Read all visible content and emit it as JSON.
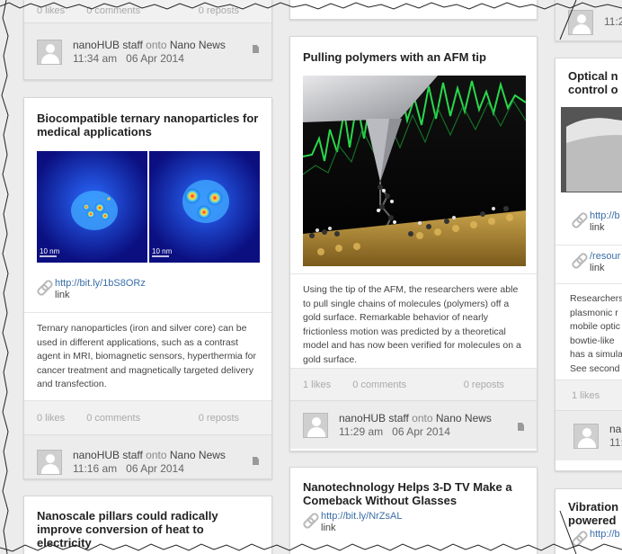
{
  "cards": {
    "c1_partial": {
      "stats": {
        "likes": "0 likes",
        "comments": "0 comments",
        "reposts": "0 reposts"
      },
      "footer": {
        "user": "nanoHUB staff",
        "onto": "onto",
        "board": "Nano News",
        "time": "11:34 am",
        "date": "06 Apr 2014"
      }
    },
    "c1_ternary": {
      "title": "Biocompatible ternary nanoparticles for medical applications",
      "scale_left": "10 nm",
      "scale_right": "10 nm",
      "link": {
        "url": "http://bit.ly/1bS8ORz",
        "label": "link"
      },
      "description": "Ternary nanoparticles (iron and silver core) can be used in different applications, such as a contrast agent in MRI, biomagnetic sensors, hyperthermia for cancer treatment and magnetically targeted delivery and transfection.",
      "stats": {
        "likes": "0 likes",
        "comments": "0 comments",
        "reposts": "0 reposts"
      },
      "footer": {
        "user": "nanoHUB staff",
        "onto": "onto",
        "board": "Nano News",
        "time": "11:16 am",
        "date": "06 Apr 2014"
      }
    },
    "c1_pillars": {
      "title": "Nanoscale pillars could radically improve conversion of heat to electricity"
    },
    "c2_afm": {
      "title": "Pulling polymers with an AFM tip",
      "description": "Using the tip of the AFM, the researchers were able to pull single chains of molecules (polymers) off a gold surface. Remarkable behavior of nearly frictionless motion was predicted by a theoretical model and has now been verified for molecules on a gold surface.",
      "stats": {
        "likes": "1 likes",
        "comments": "0 comments",
        "reposts": "0 reposts"
      },
      "footer": {
        "user": "nanoHUB staff",
        "onto": "onto",
        "board": "Nano News",
        "time": "11:29 am",
        "date": "06 Apr 2014"
      }
    },
    "c2_3dtv": {
      "title": "Nanotechnology Helps 3-D TV Make a Comeback Without Glasses",
      "link": {
        "url": "http://bit.ly/NrZsAL",
        "label": "link"
      }
    },
    "c3_top": {
      "time": "11:2"
    },
    "c3_optical": {
      "title_l1": "Optical n",
      "title_l2": "control o",
      "link1": {
        "url": "http://b",
        "label": "link"
      },
      "link2": {
        "url": "/resour",
        "label": "link"
      },
      "desc_lines": [
        "Researchers",
        "plasmonic r",
        "mobile optic",
        "bowtie-like",
        "has a simula",
        "See second"
      ],
      "stats": {
        "likes": "1 likes"
      },
      "footer": {
        "user": "nan",
        "time": "11:2"
      }
    },
    "c3_vibration": {
      "title_l1": "Vibration",
      "title_l2": "powered",
      "link": {
        "url": "http://b"
      }
    }
  }
}
